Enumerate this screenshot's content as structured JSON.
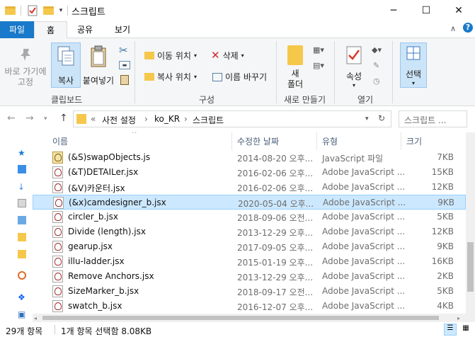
{
  "window": {
    "title": "스크립트",
    "minimize": "─",
    "maximize": "☐",
    "close": "✕"
  },
  "ribbon_tabs": [
    "파일",
    "홈",
    "공유",
    "보기"
  ],
  "ribbon": {
    "pin_label": "바로 가기에\n고정",
    "copy_label": "복사",
    "paste_label": "붙여넣기",
    "clipboard_group": "클립보드",
    "move_to": "이동 위치",
    "copy_to": "복사 위치",
    "delete": "삭제",
    "rename": "이름 바꾸기",
    "organize_group": "구성",
    "new_folder": "새\n폴더",
    "new_group": "새로 만들기",
    "properties": "속성",
    "open_group": "열기",
    "select": "선택"
  },
  "address": {
    "prefix": "«",
    "crumbs": [
      "사전 설정",
      "ko_KR",
      "스크립트"
    ],
    "separator": "›",
    "search_placeholder": "스크립트 ..."
  },
  "columns": {
    "name": "이름",
    "date": "수정한 날짜",
    "type": "유형",
    "size": "크기"
  },
  "files": [
    {
      "name": "(&S)swapObjects.js",
      "date": "2014-08-20 오후...",
      "type": "JavaScript 파일",
      "size": "7KB",
      "kind": "js"
    },
    {
      "name": "(&T)DETAILer.jsx",
      "date": "2016-02-06 오후...",
      "type": "Adobe JavaScript ...",
      "size": "15KB",
      "kind": "jsx"
    },
    {
      "name": "(&V)카운터.jsx",
      "date": "2016-02-06 오후...",
      "type": "Adobe JavaScript ...",
      "size": "12KB",
      "kind": "jsx"
    },
    {
      "name": "(&x)camdesigner_b.jsx",
      "date": "2020-05-04 오후...",
      "type": "Adobe JavaScript ...",
      "size": "9KB",
      "kind": "jsx",
      "selected": true
    },
    {
      "name": "circler_b.jsx",
      "date": "2018-09-06 오전...",
      "type": "Adobe JavaScript ...",
      "size": "5KB",
      "kind": "jsx"
    },
    {
      "name": "Divide (length).jsx",
      "date": "2013-12-29 오후...",
      "type": "Adobe JavaScript ...",
      "size": "12KB",
      "kind": "jsx"
    },
    {
      "name": "gearup.jsx",
      "date": "2017-09-05 오후...",
      "type": "Adobe JavaScript ...",
      "size": "9KB",
      "kind": "jsx"
    },
    {
      "name": "illu-ladder.jsx",
      "date": "2015-01-19 오후...",
      "type": "Adobe JavaScript ...",
      "size": "16KB",
      "kind": "jsx"
    },
    {
      "name": "Remove Anchors.jsx",
      "date": "2013-12-29 오후...",
      "type": "Adobe JavaScript ...",
      "size": "2KB",
      "kind": "jsx"
    },
    {
      "name": "SizeMarker_b.jsx",
      "date": "2018-09-17 오전...",
      "type": "Adobe JavaScript ...",
      "size": "5KB",
      "kind": "jsx"
    },
    {
      "name": "swatch_b.jsx",
      "date": "2016-12-07 오후...",
      "type": "Adobe JavaScript ...",
      "size": "4KB",
      "kind": "jsx"
    }
  ],
  "status": {
    "count": "29개 항목",
    "selection": "1개 항목 선택함 8.08KB"
  },
  "colors": {
    "file_tab": "#1979ca",
    "selection_bg": "#cce8ff",
    "selection_border": "#99d1ff",
    "folder": "#f5c84c"
  }
}
